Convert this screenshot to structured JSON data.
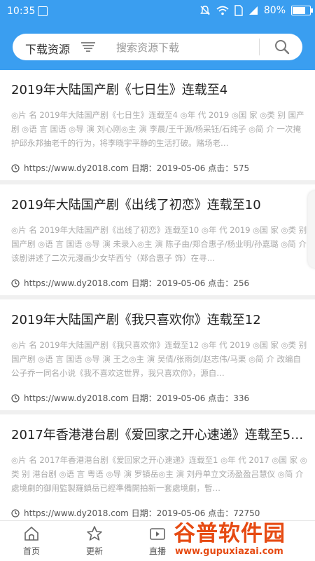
{
  "status_bar": {
    "time": "10:35",
    "battery": "80%",
    "battery_level": 0.8
  },
  "search": {
    "category": "下载资源",
    "placeholder": "搜索资源下载"
  },
  "articles": [
    {
      "title": "2019年大陆国产剧《七日生》连载至4",
      "desc": "◎片 名 2019年大陆国产剧《七日生》连载至4 ◎年 代 2019 ◎国 家 ◎类 别 国产剧 ◎语 言 国语 ◎导 演 刘心刚◎主 演 李晨/王千源/杨采钰/石纯子 ◎简 介 一次掩护邱永邦抽老千的行为，将李晓宇平静的生活打破。赌场老…",
      "meta": "https://www.dy2018.com 日期：2019-05-06 点击：575"
    },
    {
      "title": "2019年大陆国产剧《出线了初恋》连载至10",
      "desc": "◎片 名 2019年大陆国产剧《出线了初恋》连载至10 ◎年 代 2019 ◎国 家 ◎类 别 国产剧 ◎语 言 国语 ◎导 演 未录入◎主 演 陈子由/郑合惠子/杨业明/孙嘉璐 ◎简 介 该剧讲述了二次元漫画少女毕西兮（郑合惠子 饰）在寻…",
      "meta": "https://www.dy2018.com 日期：2019-05-06 点击：256"
    },
    {
      "title": "2019年大陆国产剧《我只喜欢你》连载至12",
      "desc": "◎片 名 2019年大陆国产剧《我只喜欢你》连载至12 ◎年 代 2019 ◎国 家 ◎类 别 国产剧 ◎语 言 国语 ◎导 演 王之◎主 演 吴倩/张雨剑/赵志伟/马栗 ◎简 介 改编自公子乔一同名小说《我不喜欢这世界，我只喜欢你》，源自…",
      "meta": "https://www.dy2018.com 日期：2019-05-06 点击：336"
    },
    {
      "title": "2017年香港港台剧《爱回家之开心速递》连载至5…",
      "desc": "◎片 名 2017年香港港台剧《爱回家之开心速递》连载至1 ◎年 代 2017 ◎国 家 ◎类 别 港台剧 ◎语 言 粤语 ◎导 演 罗镇岳◎主 演 刘丹单立文汤盈盈吕慧仪 ◎简 介 處境劇的御用監製羅鎮岳已經準備開拍新一套處境劇，暫…",
      "meta": "https://www.dy2018.com 日期：2019-05-06 点击：72750"
    }
  ],
  "tabs": [
    {
      "label": "首页",
      "icon": "home-icon"
    },
    {
      "label": "更新",
      "icon": "star-icon"
    },
    {
      "label": "直播",
      "icon": "video-icon"
    }
  ],
  "watermark": {
    "title": "谷普软件园",
    "url": "www.gupuxiazai.com"
  },
  "colors": {
    "accent": "#3a9ef0",
    "watermark": "#e64a12"
  }
}
